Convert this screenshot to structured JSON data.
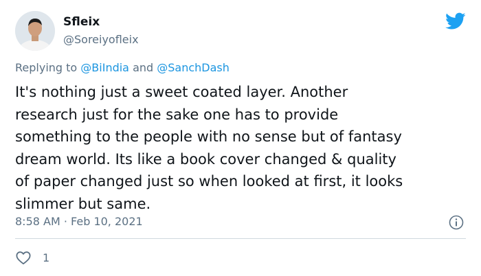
{
  "user": {
    "display_name": "Sfleix",
    "handle": "@Soreiyofleix",
    "avatar_icon": "profile-photo"
  },
  "reply": {
    "prefix": "Replying to ",
    "mention1": "@BiIndia",
    "conjunction": " and ",
    "mention2": "@SanchDash"
  },
  "tweet": {
    "text": "It's nothing just a sweet coated layer. Another\nresearch just for the sake one has to provide\nsomething to the people with no sense but of fantasy\ndream world. Its like a book cover changed & quality\nof paper changed just so when looked at first, it looks\nslimmer but same."
  },
  "meta": {
    "timestamp": "8:58 AM · Feb 10, 2021"
  },
  "actions": {
    "like_count": "1"
  },
  "icons": {
    "brand": "twitter-bird-icon",
    "info": "info-icon",
    "like": "heart-icon"
  },
  "colors": {
    "accent": "#1da1f2",
    "mention": "#1b95e0",
    "secondary_text": "#5b7083"
  }
}
